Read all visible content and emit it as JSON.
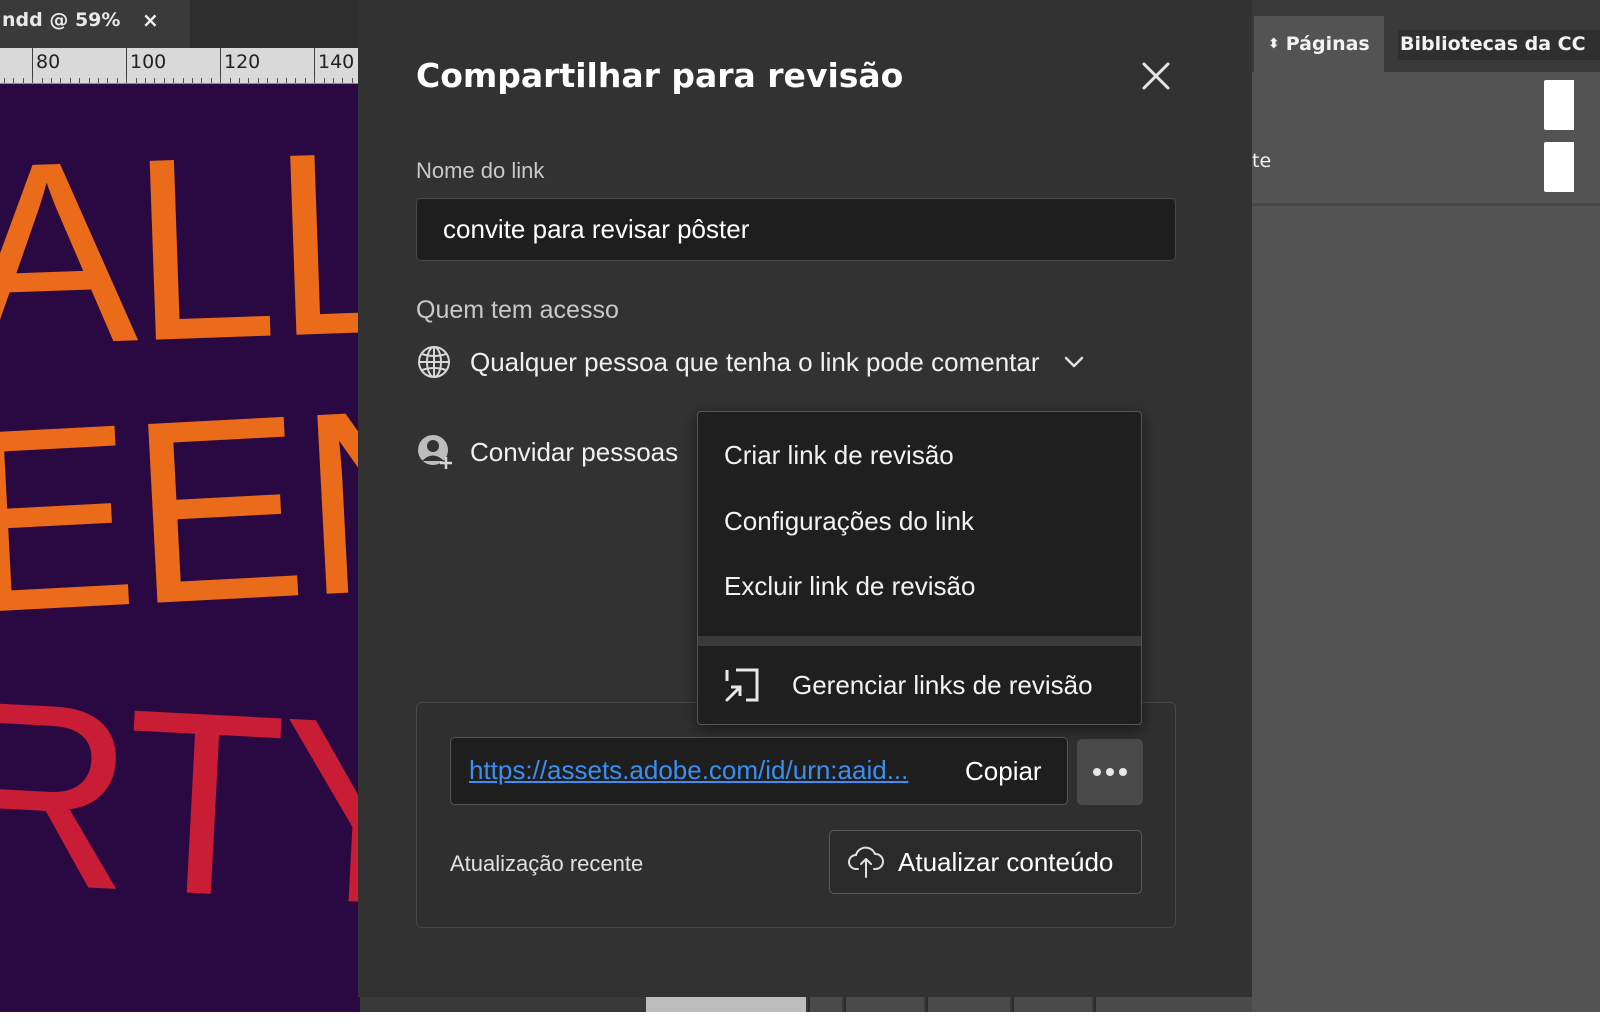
{
  "app": {
    "document_tab": {
      "label": "ndd @ 59%",
      "close_glyph": "×"
    },
    "ruler": {
      "labels": [
        "80",
        "100",
        "120",
        "140"
      ]
    },
    "poster": {
      "lines": [
        "ALLO",
        "EEN",
        "RTY"
      ]
    },
    "right_panel": {
      "tabs": [
        {
          "label": "Páginas",
          "icon": "up-down-arrows-icon"
        },
        {
          "label": "Bibliotecas da CC"
        }
      ],
      "partial_text": "te"
    }
  },
  "dialog": {
    "title": "Compartilhar para revisão",
    "close_icon": "close-icon",
    "link_name": {
      "label": "Nome do link",
      "value": "convite para revisar pôster"
    },
    "access": {
      "label": "Quem tem acesso",
      "icon": "globe-icon",
      "value": "Qualquer pessoa que tenha o link pode comentar",
      "dropdown_icon": "chevron-down-icon"
    },
    "invite": {
      "icon": "invite-person-icon",
      "label": "Convidar pessoas"
    },
    "link_box": {
      "url": "https://assets.adobe.com/id/urn:aaid...",
      "copy_label": "Copiar",
      "more_icon": "more-options-icon",
      "recent_label": "Atualização recente",
      "update_label": "Atualizar conteúdo",
      "update_icon": "cloud-upload-icon"
    },
    "menu": {
      "items": [
        "Criar link de revisão",
        "Configurações do link",
        "Excluir link de revisão"
      ],
      "manage": {
        "icon": "manage-links-icon",
        "label": "Gerenciar links de revisão"
      }
    }
  },
  "colors": {
    "dialog_bg": "#323232",
    "link_blue": "#3d8ef2",
    "poster_bg": "#2a0942",
    "poster_orange": "#ea6b19",
    "poster_red": "#c81d35"
  }
}
